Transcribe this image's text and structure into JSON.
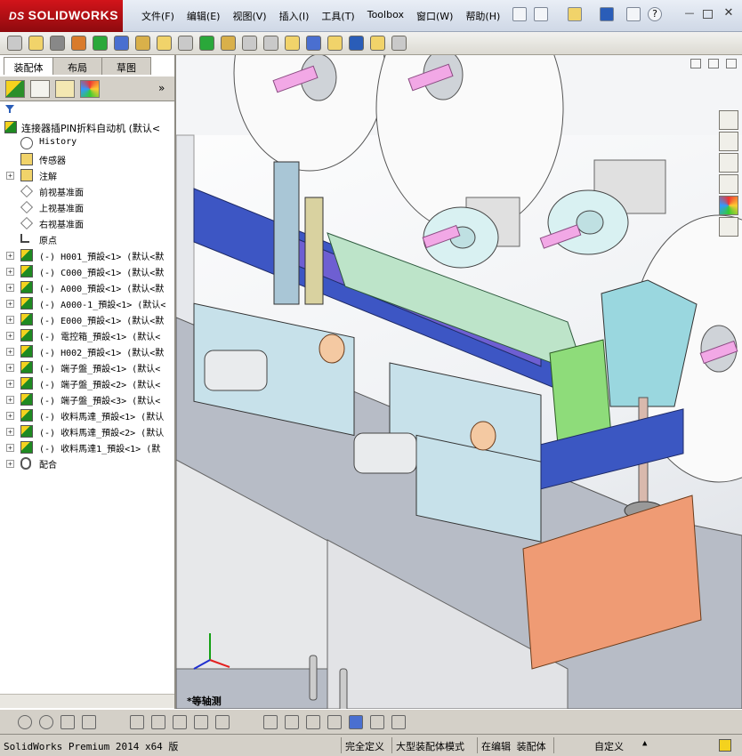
{
  "app": {
    "logo_prefix": "DS",
    "logo": "SOLIDWORKS"
  },
  "menu": [
    "文件(F)",
    "编辑(E)",
    "视图(V)",
    "插入(I)",
    "工具(T)",
    "Toolbox",
    "窗口(W)",
    "帮助(H)"
  ],
  "tabs": [
    "装配体",
    "布局",
    "草图"
  ],
  "tree": {
    "root": "连接器插PIN折料自动机  (默认<",
    "items": [
      {
        "icon": "history-icon",
        "label": "History",
        "expandable": false
      },
      {
        "icon": "sensor-icon",
        "label": "传感器",
        "expandable": false
      },
      {
        "icon": "annotation-icon",
        "label": "注解",
        "expandable": true
      },
      {
        "icon": "plane-icon",
        "label": "前视基准面",
        "expandable": false
      },
      {
        "icon": "plane-icon",
        "label": "上视基准面",
        "expandable": false
      },
      {
        "icon": "plane-icon",
        "label": "右视基准面",
        "expandable": false
      },
      {
        "icon": "origin-icon",
        "label": "原点",
        "expandable": false
      },
      {
        "icon": "assembly-icon",
        "label": "(-) H001_預設<1> (默认<默",
        "expandable": true
      },
      {
        "icon": "assembly-icon",
        "label": "(-) C000_預設<1> (默认<默",
        "expandable": true
      },
      {
        "icon": "assembly-icon",
        "label": "(-) A000_預設<1> (默认<默",
        "expandable": true
      },
      {
        "icon": "assembly-icon",
        "label": "(-) A000-1_預設<1> (默认<",
        "expandable": true
      },
      {
        "icon": "assembly-icon",
        "label": "(-) E000_預設<1> (默认<默",
        "expandable": true
      },
      {
        "icon": "assembly-icon",
        "label": "(-) 電控箱_預設<1> (默认<",
        "expandable": true
      },
      {
        "icon": "assembly-icon",
        "label": "(-) H002_預設<1> (默认<默",
        "expandable": true
      },
      {
        "icon": "assembly-icon",
        "label": "(-) 端子盤_預設<1> (默认<",
        "expandable": true
      },
      {
        "icon": "assembly-icon",
        "label": "(-) 端子盤_預設<2> (默认<",
        "expandable": true
      },
      {
        "icon": "assembly-icon",
        "label": "(-) 端子盤_預設<3> (默认<",
        "expandable": true
      },
      {
        "icon": "assembly-icon",
        "label": "(-) 收料馬達_預設<1> (默认",
        "expandable": true
      },
      {
        "icon": "assembly-icon",
        "label": "(-) 收料馬達_預設<2> (默认",
        "expandable": true
      },
      {
        "icon": "assembly-icon",
        "label": "(-) 收料馬達1_預設<1> (默",
        "expandable": true
      },
      {
        "icon": "mates-icon",
        "label": "配合",
        "expandable": true
      }
    ]
  },
  "viewport": {
    "view_label": "*等轴测"
  },
  "status": {
    "product": "SolidWorks Premium 2014 x64 版",
    "fully_defined": "完全定义",
    "large_assembly": "大型装配体模式",
    "editing": "在编辑 装配体",
    "custom": "自定义"
  },
  "colors": {
    "logo_red": "#c81017",
    "frame_blue": "#3b57c2",
    "base_gray": "#b9bfcb"
  }
}
